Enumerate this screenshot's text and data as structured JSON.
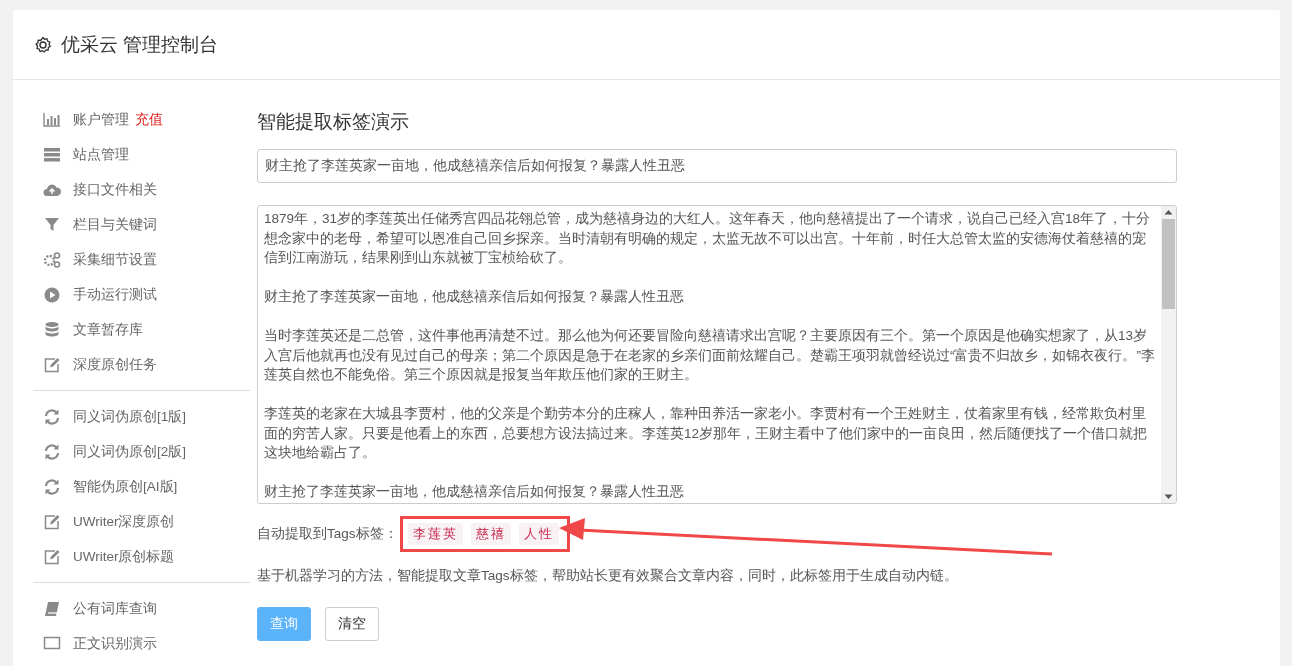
{
  "header": {
    "title": "优采云 管理控制台"
  },
  "sidebar": {
    "groups": [
      {
        "items": [
          {
            "label": "账户管理",
            "badge": "充值"
          },
          {
            "label": "站点管理"
          },
          {
            "label": "接口文件相关"
          },
          {
            "label": "栏目与关键词"
          },
          {
            "label": "采集细节设置"
          },
          {
            "label": "手动运行测试"
          },
          {
            "label": "文章暂存库"
          },
          {
            "label": "深度原创任务"
          }
        ]
      },
      {
        "items": [
          {
            "label": "同义词伪原创[1版]"
          },
          {
            "label": "同义词伪原创[2版]"
          },
          {
            "label": "智能伪原创[AI版]"
          },
          {
            "label": "UWriter深度原创"
          },
          {
            "label": "UWriter原创标题"
          }
        ]
      },
      {
        "items": [
          {
            "label": "公有词库查询"
          },
          {
            "label": "正文识别演示"
          }
        ]
      }
    ]
  },
  "content": {
    "heading": "智能提取标签演示",
    "title_field": {
      "value": "财主抢了李莲英家一亩地，他成慈禧亲信后如何报复？暴露人性丑恶"
    },
    "article_field": {
      "paragraphs": [
        "1879年，31岁的李莲英出任储秀宫四品花翎总管，成为慈禧身边的大红人。这年春天，他向慈禧提出了一个请求，说自己已经入宫18年了，十分想念家中的老母，希望可以恩准自己回乡探亲。当时清朝有明确的规定，太监无故不可以出宫。十年前，时任大总管太监的安德海仗着慈禧的宠信到江南游玩，结果刚到山东就被丁宝桢给砍了。",
        "财主抢了李莲英家一亩地，他成慈禧亲信后如何报复？暴露人性丑恶",
        "当时李莲英还是二总管，这件事他再清楚不过。那么他为何还要冒险向慈禧请求出宫呢？主要原因有三个。第一个原因是他确实想家了，从13岁入宫后他就再也没有见过自己的母亲；第二个原因是急于在老家的乡亲们面前炫耀自己。楚霸王项羽就曾经说过“富贵不归故乡，如锦衣夜行。”李莲英自然也不能免俗。第三个原因就是报复当年欺压他们家的王财主。",
        "李莲英的老家在大城县李贾村，他的父亲是个勤劳本分的庄稼人，靠种田养活一家老小。李贾村有一个王姓财主，仗着家里有钱，经常欺负村里面的穷苦人家。只要是他看上的东西，总要想方设法搞过来。李莲英12岁那年，王财主看中了他们家中的一亩良田，然后随便找了一个借口就把这块地给霸占了。",
        "财主抢了李莲英家一亩地，他成慈禧亲信后如何报复？暴露人性丑恶"
      ]
    },
    "tags_label": "自动提取到Tags标签：",
    "tags": [
      "李莲英",
      "慈禧",
      "人性"
    ],
    "description": "基于机器学习的方法，智能提取文章Tags标签，帮助站长更有效聚合文章内容，同时，此标签用于生成自动内链。",
    "buttons": [
      {
        "label": "查询",
        "kind": "primary"
      },
      {
        "label": "清空",
        "kind": "default"
      }
    ]
  }
}
